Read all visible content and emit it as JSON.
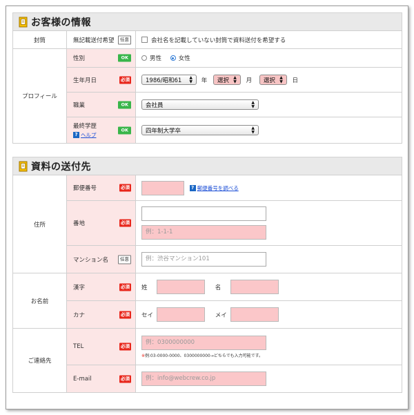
{
  "customer": {
    "title": "お客様の情報",
    "envelope": {
      "category": "封筒",
      "label": "無記載送付希望",
      "badge": "任意",
      "checkbox_label": "会社名を記載していない封筒で資料送付を希望する"
    },
    "profile_category": "プロフィール",
    "gender": {
      "label": "性別",
      "badge": "OK",
      "options": [
        "男性",
        "女性"
      ],
      "selected": "女性"
    },
    "birthdate": {
      "label": "生年月日",
      "badge": "必須",
      "year_value": "1986/昭和61",
      "year_unit": "年",
      "month_value": "選択",
      "month_unit": "月",
      "day_value": "選択",
      "day_unit": "日"
    },
    "occupation": {
      "label": "職業",
      "badge": "OK",
      "value": "会社員"
    },
    "education": {
      "label": "最終学歴",
      "badge": "OK",
      "help_label": "ヘルプ",
      "value": "四年制大学卒"
    }
  },
  "destination": {
    "title": "資料の送付先",
    "address_category": "住所",
    "postal": {
      "label": "郵便番号",
      "badge": "必須",
      "value": "",
      "lookup_link": "郵便番号を調べる"
    },
    "street": {
      "label": "番地",
      "badge": "必須",
      "value": "",
      "placeholder": "例：1-1-1"
    },
    "mansion": {
      "label": "マンション名",
      "badge": "任意",
      "placeholder": "例：渋谷マンション101"
    },
    "name_category": "お名前",
    "kanji": {
      "label": "漢字",
      "badge": "必須",
      "last_label": "姓",
      "first_label": "名"
    },
    "kana": {
      "label": "カナ",
      "badge": "必須",
      "last_label": "セイ",
      "first_label": "メイ"
    },
    "contact_category": "ご連絡先",
    "tel": {
      "label": "TEL",
      "badge": "必須",
      "placeholder": "例：0300000000",
      "note_mark": "※",
      "note": "例:03-0000-0000、0300000000→どちらでも入力可能です。"
    },
    "email": {
      "label": "E-mail",
      "badge": "必須",
      "placeholder": "例：info@webcrew.co.jp"
    }
  },
  "colors": {
    "required_badge": "#e8261b",
    "ok_badge": "#39b54a",
    "label_bg": "#fce6e6",
    "input_required_bg": "#fbc7c9",
    "link": "#1a4dd6",
    "radio_selected": "#2d7ad6"
  }
}
